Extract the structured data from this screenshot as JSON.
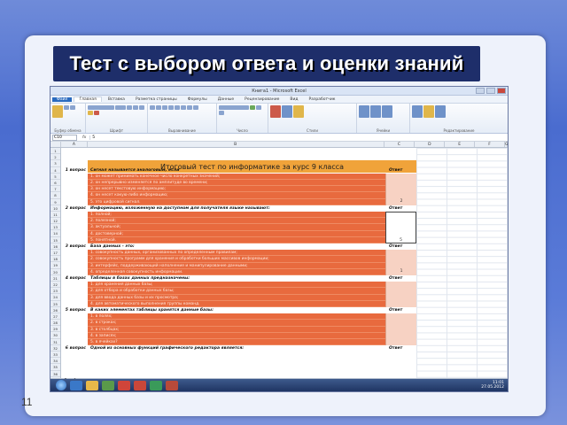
{
  "slide": {
    "title": "Тест с выбором ответа и оценки знаний",
    "number": "11"
  },
  "window": {
    "title": "Книга1 - Microsoft Excel"
  },
  "ribbon": {
    "tabs": [
      "Файл",
      "Главная",
      "Вставка",
      "Разметка страницы",
      "Формулы",
      "Данные",
      "Рецензирование",
      "Вид",
      "Разработчик"
    ],
    "groups": [
      "Буфер обмена",
      "Шрифт",
      "Выравнивание",
      "Число",
      "Стили",
      "Ячейки",
      "Редактирование"
    ]
  },
  "formula_bar": {
    "name_box": "C10",
    "fx": "fx",
    "value": "5"
  },
  "columns": [
    "A",
    "B",
    "C",
    "D",
    "E",
    "F",
    "G"
  ],
  "rows": [
    "1",
    "2",
    "3",
    "4",
    "5",
    "6",
    "7",
    "8",
    "9",
    "10",
    "11",
    "12",
    "13",
    "14",
    "15",
    "16",
    "17",
    "18",
    "19",
    "20",
    "21",
    "22",
    "23",
    "24",
    "25",
    "26",
    "27",
    "28",
    "29",
    "30",
    "31",
    "32",
    "33",
    "34",
    "35",
    "36"
  ],
  "sheet": {
    "header": "Итоговый тест по информатике за курс 9 класса",
    "answer_header": "Ответ",
    "questions": [
      {
        "label": "1 вопрос",
        "text": "Сигнал называется аналоговым, если",
        "options": [
          "1. он может принимать конечное число конкретных значений;",
          "2. он непрерывно изменяется по амплитуде во времени;",
          "3. он несет текстовую информацию;",
          "4. он несет какую-либо информацию;",
          "5. это цифровой сигнал."
        ],
        "answer": "2"
      },
      {
        "label": "2 вопрос",
        "text": "Информацию, изложенную на доступном для получателя языке называют:",
        "options": [
          "1. полной;",
          "2. полезной;",
          "3. актуальной;",
          "4. достоверной;",
          "5. понятной."
        ],
        "answer": "5"
      },
      {
        "label": "3 вопрос",
        "text": "База данных - это:",
        "options": [
          "1. совокупность данных, организованных по определенным правилам;",
          "2. совокупность программ для хранения и обработки больших массивов информации;",
          "3. интерфейс, поддерживающий наполнение и манипулирование данными;",
          "4. определенная совокупность информации."
        ],
        "answer": "1"
      },
      {
        "label": "4 вопрос",
        "text": "Таблицы в базах данных предназначены:",
        "options": [
          "1. для хранения данных базы;",
          "2. для отбора и обработки данных базы;",
          "3. для ввода данных базы и их просмотра;",
          "4. для автоматического выполнения группы команд."
        ],
        "answer": ""
      },
      {
        "label": "5 вопрос",
        "text": "В каких элементах таблицы хранятся данные базы:",
        "options": [
          "1. в полях;",
          "2. в строках;",
          "3. в столбцах;",
          "4. в записях;",
          "5. в ячейках?"
        ],
        "answer": ""
      },
      {
        "label": "6 вопрос",
        "text": "Одной из основных функций графического редактора является:",
        "options": [],
        "answer": ""
      }
    ]
  },
  "sheet_tabs": [
    "Лист1",
    "Лист2",
    "Лист3"
  ],
  "status": {
    "left": "Готово",
    "right": "100%"
  },
  "taskbar": {
    "time": "11:01",
    "date": "27.05.2012"
  },
  "colors": {
    "header_fill": "#f0a33a",
    "options_fill": "#e86a3e",
    "answer_fill": "#f7d2c3",
    "title_band": "#1e2e6a"
  }
}
